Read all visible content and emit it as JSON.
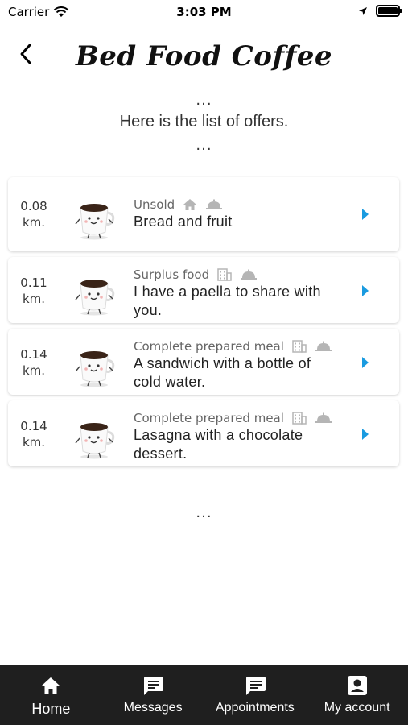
{
  "status_bar": {
    "carrier": "Carrier",
    "time": "3:03 PM"
  },
  "header": {
    "app_title": "Bed Food Coffee"
  },
  "intro": {
    "dots_top": "...",
    "text": "Here is the list of offers.",
    "dots_bottom": "..."
  },
  "offers": [
    {
      "distance": "0.08",
      "unit": "km.",
      "category": "Unsold",
      "title_line1": "Bread and fruit",
      "title_line2": "",
      "category_icon": "house-icon",
      "service_icon": "cloche-icon"
    },
    {
      "distance": "0.11",
      "unit": "km.",
      "category": "Surplus food",
      "title_line1": "I have a paella to share with",
      "title_line2": "you.",
      "category_icon": "building-icon",
      "service_icon": "cloche-icon"
    },
    {
      "distance": "0.14",
      "unit": "km.",
      "category": "Complete prepared meal",
      "title_line1": "A sandwich with a bottle of",
      "title_line2": "cold water.",
      "category_icon": "building-icon",
      "service_icon": "cloche-icon"
    },
    {
      "distance": "0.14",
      "unit": "km.",
      "category": "Complete prepared meal",
      "title_line1": "Lasagna with a chocolate",
      "title_line2": "dessert.",
      "category_icon": "building-icon",
      "service_icon": "cloche-icon"
    }
  ],
  "footer_dots": "...",
  "tabbar": {
    "items": [
      {
        "label": "Home",
        "icon": "home-icon",
        "active": true
      },
      {
        "label": "Messages",
        "icon": "message-icon",
        "active": false
      },
      {
        "label": "Appointments",
        "icon": "message-icon",
        "active": false
      },
      {
        "label": "My account",
        "icon": "account-icon",
        "active": false
      }
    ]
  },
  "colors": {
    "arrow": "#1a9be0",
    "tabbar_bg": "#1f1f1f",
    "muted_icon": "#b5b5b5"
  }
}
